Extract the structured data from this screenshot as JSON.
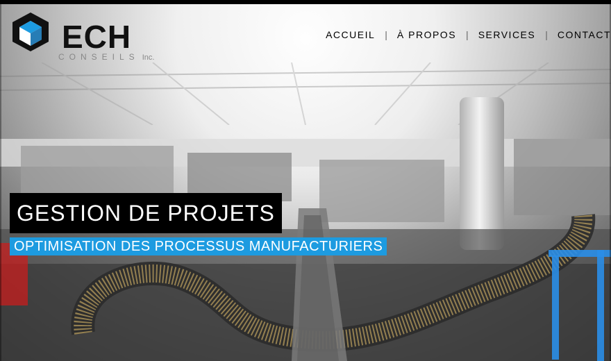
{
  "brand": {
    "name": "ECH",
    "subtitle": "CONSEILS",
    "suffix": "Inc.",
    "colors": {
      "black": "#111111",
      "blue": "#1d9be0"
    }
  },
  "nav": {
    "items": [
      "ACCUEIL",
      "À PROPOS",
      "SERVICES",
      "CONTACT"
    ]
  },
  "hero": {
    "title": "GESTION DE PROJETS",
    "subtitle": "OPTIMISATION DES PROCESSUS MANUFACTURIERS"
  }
}
